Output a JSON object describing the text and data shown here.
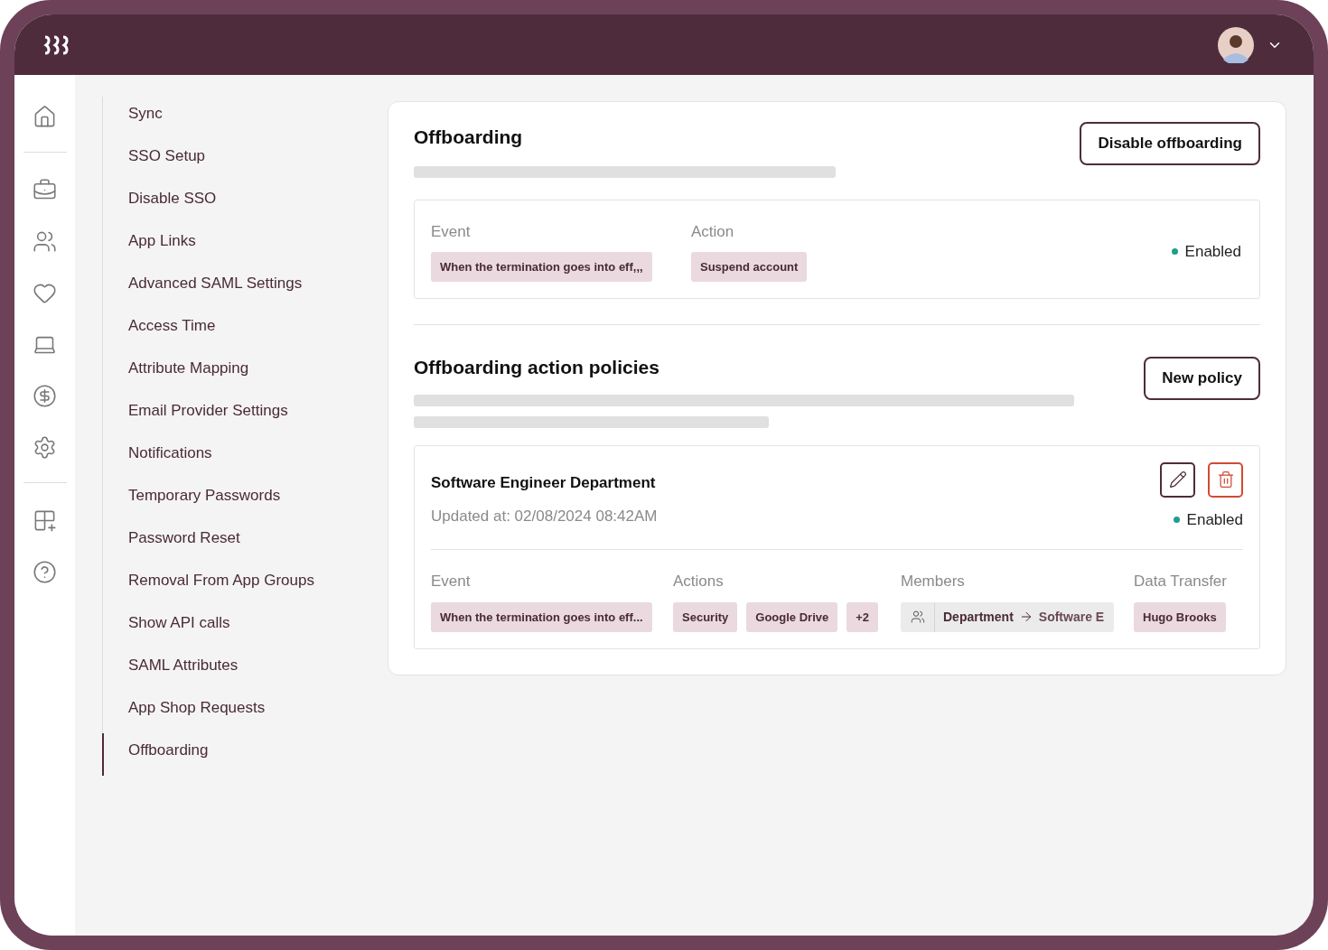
{
  "submenu": {
    "items": [
      {
        "label": "Sync",
        "selected": false
      },
      {
        "label": "SSO Setup",
        "selected": false
      },
      {
        "label": "Disable SSO",
        "selected": false
      },
      {
        "label": "App Links",
        "selected": false
      },
      {
        "label": "Advanced SAML Settings",
        "selected": false
      },
      {
        "label": "Access Time",
        "selected": false
      },
      {
        "label": "Attribute Mapping",
        "selected": false
      },
      {
        "label": "Email Provider Settings",
        "selected": false
      },
      {
        "label": "Notifications",
        "selected": false
      },
      {
        "label": "Temporary Passwords",
        "selected": false
      },
      {
        "label": "Password Reset",
        "selected": false
      },
      {
        "label": "Removal From App Groups",
        "selected": false
      },
      {
        "label": "Show API calls",
        "selected": false
      },
      {
        "label": "SAML Attributes",
        "selected": false
      },
      {
        "label": "App Shop Requests",
        "selected": false
      },
      {
        "label": "Offboarding",
        "selected": true
      }
    ]
  },
  "offboarding": {
    "title": "Offboarding",
    "button": "Disable offboarding",
    "event_label": "Event",
    "event": "When the termination goes into eff,,,",
    "action_label": "Action",
    "action": "Suspend account",
    "status": {
      "label": "Enabled",
      "enabled": true
    }
  },
  "policies": {
    "title": "Offboarding action policies",
    "button": "New policy",
    "items": [
      {
        "name": "Software Engineer Department",
        "updated": "Updated at: 02/08/2024 08:42AM",
        "status": {
          "label": "Enabled",
          "enabled": true
        },
        "event_label": "Event",
        "event": "When the termination goes into eff...",
        "actions_label": "Actions",
        "actions": [
          "Security",
          "Google Drive",
          "+2"
        ],
        "members_label": "Members",
        "members_from": "Department",
        "members_to": "Software E",
        "transfer_label": "Data Transfer",
        "transfer": "Hugo Brooks"
      }
    ]
  }
}
